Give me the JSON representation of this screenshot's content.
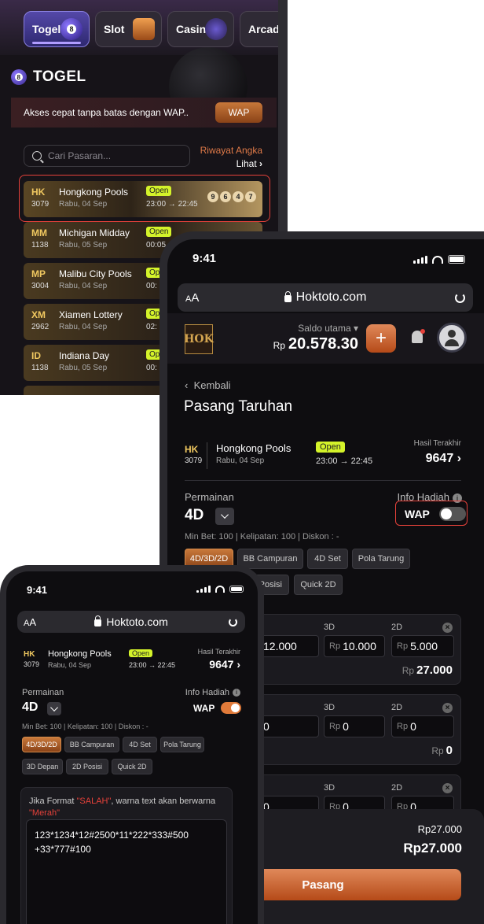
{
  "p1": {
    "tabs": [
      "Togel",
      "Slot",
      "Casino",
      "Arcade"
    ],
    "header": "TOGEL",
    "ball_num": "8",
    "wap_text": "Akses cepat tanpa batas dengan WAP..",
    "wap_btn": "WAP",
    "search_placeholder": "Cari Pasaran...",
    "riwayat": "Riwayat Angka",
    "lihat": "Lihat",
    "markets": [
      {
        "code": "HK",
        "num": "3079",
        "name": "Hongkong Pools",
        "date": "Rabu, 04 Sep",
        "status": "Open",
        "time": "23:00 → 22:45",
        "result": [
          "9",
          "6",
          "4",
          "7"
        ]
      },
      {
        "code": "MM",
        "num": "1138",
        "name": "Michigan Midday",
        "date": "Rabu, 05 Sep",
        "status": "Open",
        "time": "00:05"
      },
      {
        "code": "MP",
        "num": "3004",
        "name": "Malibu City Pools",
        "date": "Rabu, 04 Sep",
        "status": "Op",
        "time": "00:"
      },
      {
        "code": "XM",
        "num": "2962",
        "name": "Xiamen Lottery",
        "date": "Rabu, 04 Sep",
        "status": "Op",
        "time": "02:"
      },
      {
        "code": "ID",
        "num": "1138",
        "name": "Indiana Day",
        "date": "Rabu, 05 Sep",
        "status": "Op",
        "time": "00:"
      }
    ]
  },
  "p2": {
    "clock": "9:41",
    "aa_small": "A",
    "aa_big": "A",
    "url": "Hoktoto.com",
    "logo": "HOK",
    "saldo_label": "Saldo utama",
    "saldo_cur": "Rp",
    "saldo_value": "20.578.30",
    "back": "Kembali",
    "title": "Pasang Taruhan",
    "market": {
      "code": "HK",
      "num": "3079",
      "name": "Hongkong Pools",
      "date": "Rabu, 04 Sep",
      "status": "Open",
      "time": "23:00 → 22:45",
      "hasil_label": "Hasil Terakhir",
      "hasil": "9647"
    },
    "permainan": "Permainan",
    "info_hadiah": "Info Hadiah",
    "game": "4D",
    "wap": "WAP",
    "minbet": "Min Bet: 100  |  Kelipatan: 100  |  Diskon : -",
    "chips": [
      "4D/3D/2D",
      "BB Campuran",
      "4D Set",
      "Pola Tarung",
      "3D Depan",
      "2D Posisi",
      "Quick 2D"
    ],
    "chips_visible_row2": [
      "D Posisi",
      "Quick 2D"
    ],
    "cards": [
      {
        "labels": [
          "3D",
          "2D"
        ],
        "vals": [
          "12.000",
          "10.000",
          "5.000"
        ],
        "total": "27.000"
      },
      {
        "labels": [
          "3D",
          "2D"
        ],
        "vals": [
          "0",
          "0",
          "0"
        ],
        "total": "0"
      },
      {
        "labels": [
          "3D",
          "2D"
        ],
        "vals": [
          "0",
          "0",
          "0"
        ]
      }
    ],
    "cur": "Rp",
    "sum1": "Rp27.000",
    "sum2": "Rp27.000",
    "pasang": "Pasang"
  },
  "p3": {
    "clock": "9:41",
    "url": "Hoktoto.com",
    "market": {
      "code": "HK",
      "num": "3079",
      "name": "Hongkong Pools",
      "date": "Rabu, 04 Sep",
      "status": "Open",
      "time": "23:00 → 22:45",
      "hasil_label": "Hasil Terakhir",
      "hasil": "9647"
    },
    "permainan": "Permainan",
    "info_hadiah": "Info Hadiah",
    "game": "4D",
    "wap": "WAP",
    "minbet": "Min Bet: 100  |  Kelipatan: 100  |  Diskon : -",
    "chips": [
      "4D/3D/2D",
      "BB Campuran",
      "4D Set",
      "Pola Tarung",
      "3D Depan",
      "2D Posisi",
      "Quick 2D"
    ],
    "hint_a": "Jika Format ",
    "hint_b": "\"SALAH\"",
    "hint_c": ", warna text akan berwarna",
    "hint_d": "\"Merah\"",
    "input_l1": "123*1234*12#2500*11*222*333#500",
    "input_l2": "+33*777#100"
  },
  "colors": {
    "accent": "#e07a3a",
    "open": "#d4f32a",
    "gold": "#f0c860",
    "red": "#e5413a"
  }
}
